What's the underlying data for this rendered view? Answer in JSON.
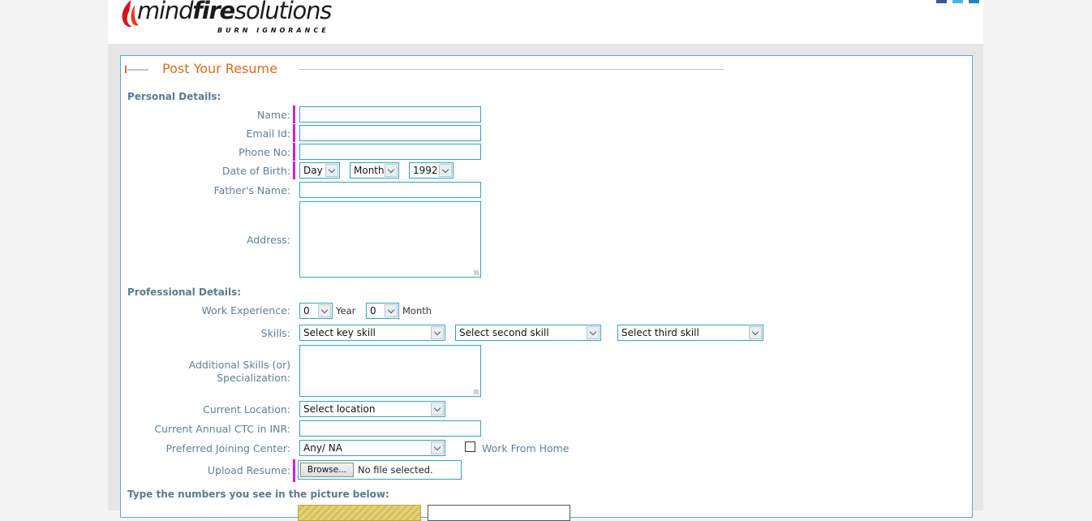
{
  "header": {
    "logo_light": "mind",
    "logo_bold": "fire",
    "logo_rest": "solutions",
    "tagline": "BURN IGNORANCE"
  },
  "form": {
    "title": "Post Your Resume",
    "personal_title": "Personal Details:",
    "name_label": "Name:",
    "email_label": "Email Id:",
    "phone_label": "Phone No:",
    "dob_label": "Date of Birth:",
    "dob_day": "Day",
    "dob_month": "Month",
    "dob_year": "1992",
    "father_label": "Father's Name:",
    "address_label": "Address:",
    "professional_title": "Professional Details:",
    "exp_label": "Work Experience:",
    "exp_years": "0",
    "exp_year_unit": "Year",
    "exp_months": "0",
    "exp_month_unit": "Month",
    "skills_label": "Skills:",
    "skill_1": "Select key skill",
    "skill_2": "Select second skill",
    "skill_3": "Select third skill",
    "additional_label_1": "Additional Skills (or)",
    "additional_label_2": "Specialization:",
    "location_label": "Current Location:",
    "location_value": "Select location",
    "ctc_label": "Current Annual CTC in INR:",
    "joining_label": "Preferred Joining Center:",
    "joining_value": "Any/ NA",
    "wfh_label": "Work From Home",
    "upload_label": "Upload Resume:",
    "browse_label": "Browse...",
    "file_status": "No file selected.",
    "captcha_title": "Type the numbers you see in the picture below:"
  },
  "colors": {
    "accent": "#e06a1c",
    "label": "#5f7f92",
    "border": "#3aa0ba",
    "required": "#d81bcd"
  }
}
